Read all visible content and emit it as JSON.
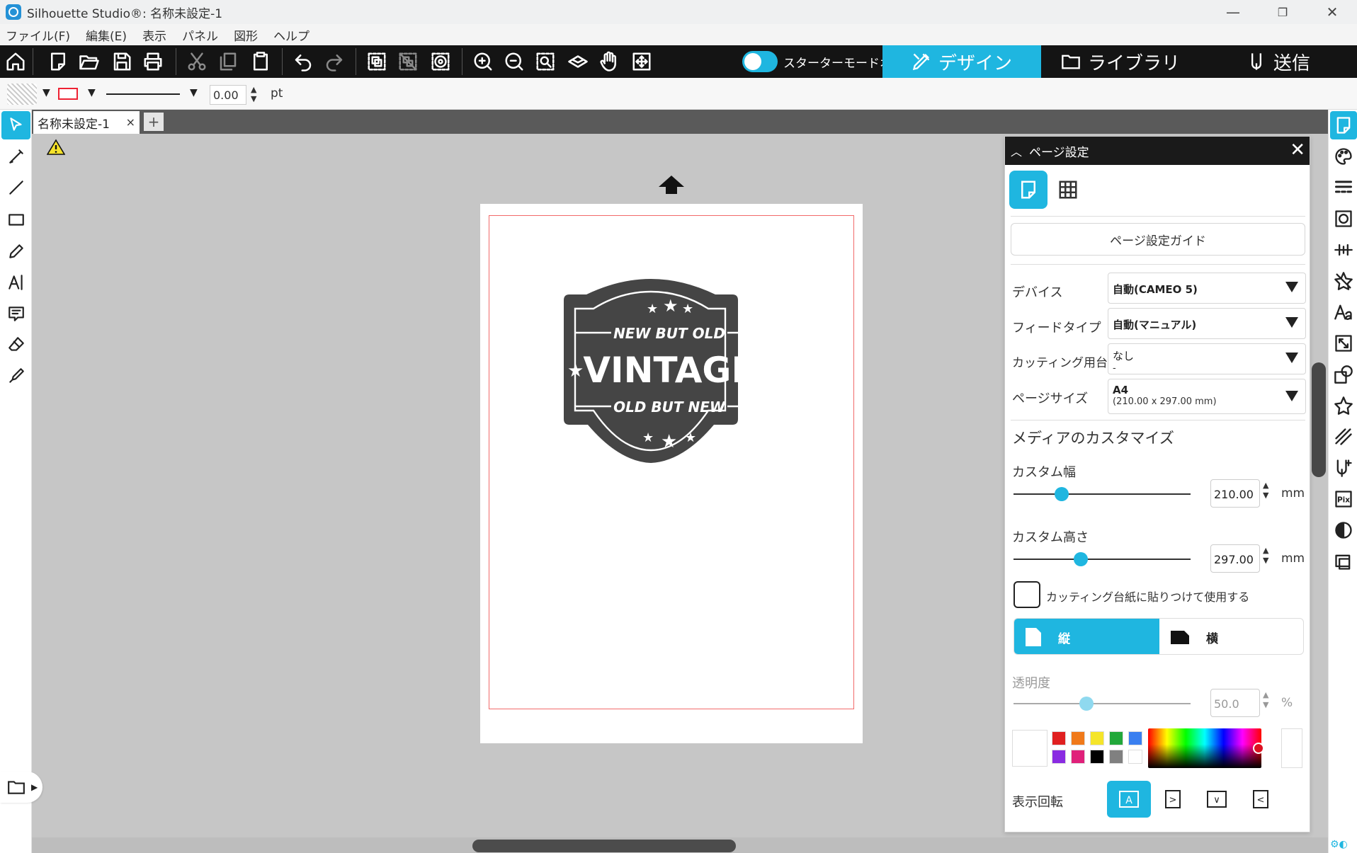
{
  "window": {
    "title": "Silhouette Studio®: 名称未設定-1",
    "min_glyph": "—",
    "max_glyph": "❐",
    "close_glyph": "✕"
  },
  "menu": [
    "ファイル(F)",
    "編集(E)",
    "表示",
    "パネル",
    "図形",
    "ヘルプ"
  ],
  "toolbar": {
    "starter_mode_label": "スターターモードオフ",
    "nav_tabs": {
      "design": "デザイン",
      "library": "ライブラリ",
      "send": "送信"
    }
  },
  "options_bar": {
    "line_width": "0.00",
    "unit": "pt",
    "arrow": "▼"
  },
  "document_tab": {
    "name": "名称未設定-1",
    "close": "×",
    "add": "+"
  },
  "panel": {
    "title": "ページ設定",
    "guide_button": "ページ設定ガイド",
    "rows": [
      {
        "label": "デバイス",
        "value": "自動(CAMEO 5)",
        "sub": ""
      },
      {
        "label": "フィードタイプ",
        "value": "自動(マニュアル)",
        "sub": ""
      },
      {
        "label": "カッティング用台紙",
        "value": "なし",
        "sub": "-"
      },
      {
        "label": "ページサイズ",
        "value": "A4",
        "sub": "(210.00 x 297.00 mm)"
      }
    ],
    "media_section_title": "メディアのカスタマイズ",
    "custom_width": {
      "label": "カスタム幅",
      "value": "210.00",
      "unit": "mm",
      "slider_fraction": 0.27
    },
    "custom_height": {
      "label": "カスタム高さ",
      "value": "297.00",
      "unit": "mm",
      "slider_fraction": 0.38
    },
    "stick_checkbox_label": "カッティング台紙に貼りつけて使用する",
    "orientation": {
      "portrait": "縦",
      "landscape": "横",
      "selected": "portrait"
    },
    "transparency": {
      "label": "透明度",
      "value": "50.0",
      "unit": "%",
      "slider_fraction": 0.41
    },
    "palette": [
      "#e02020",
      "#f07a1a",
      "#f5e52a",
      "#22a83a",
      "#3a7ff0",
      "#8a2be2",
      "#e0207a",
      "#000000",
      "#808080",
      "#ffffff"
    ],
    "rotation_label": "表示回転",
    "rotation_options": [
      "A",
      ">",
      "∨",
      "<"
    ],
    "spin_up": "▲",
    "spin_down": "▼"
  },
  "design": {
    "badge_top": "NEW BUT OLD",
    "badge_main": "VINTAGE",
    "badge_bottom": "OLD BUT NEW"
  },
  "colors": {
    "accent": "#1fb6e0",
    "toolbar_bg": "#141414",
    "canvas_bg": "#c6c6c6",
    "page_margin": "#f26a6a",
    "badge_fill": "#454545"
  }
}
